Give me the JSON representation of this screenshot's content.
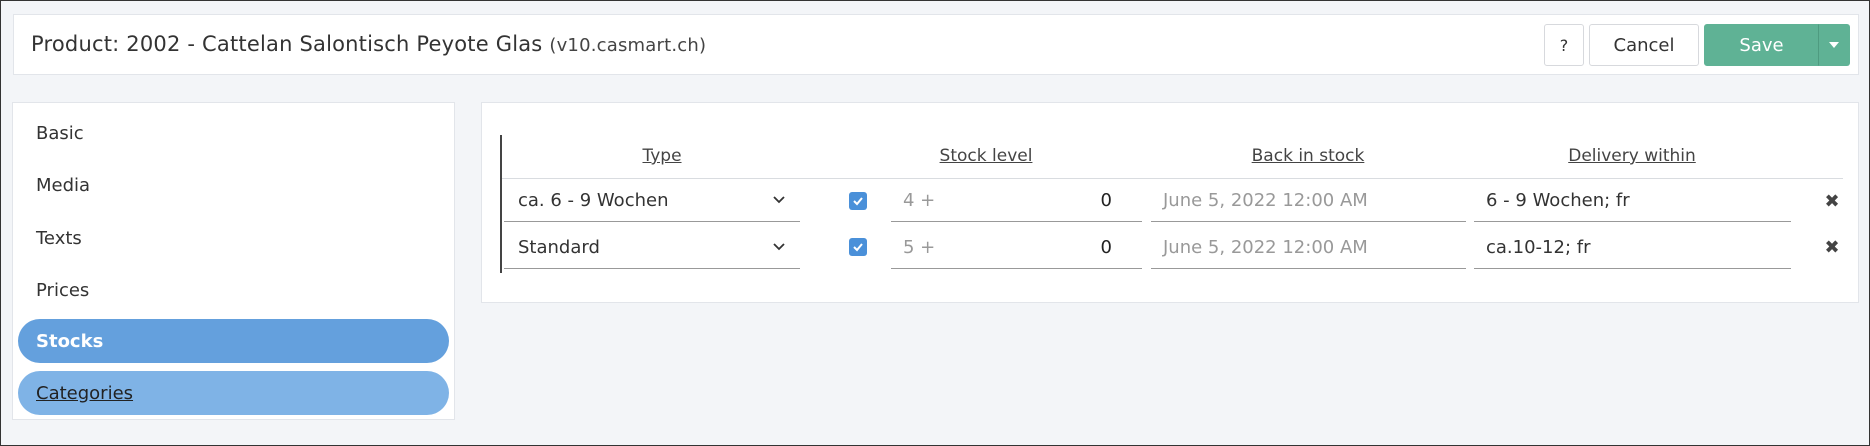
{
  "header": {
    "title": "Product: 2002 - Cattelan Salontisch Peyote Glas",
    "domain": "(v10.casmart.ch)",
    "help_label": "?",
    "cancel_label": "Cancel",
    "save_label": "Save"
  },
  "sidebar": {
    "items": [
      {
        "label": "Basic"
      },
      {
        "label": "Media"
      },
      {
        "label": "Texts"
      },
      {
        "label": "Prices"
      },
      {
        "label": "Stocks"
      },
      {
        "label": "Categories"
      }
    ]
  },
  "table": {
    "columns": [
      "Type",
      "Stock level",
      "Back in stock",
      "Delivery within"
    ],
    "rows": [
      {
        "type": "ca. 6 - 9 Wochen",
        "checked": true,
        "stock_placeholder": "4 +",
        "stock_value": "0",
        "back_in_stock": "June 5, 2022 12:00 AM",
        "delivery": "6 - 9 Wochen; fr"
      },
      {
        "type": "Standard",
        "checked": true,
        "stock_placeholder": "5 +",
        "stock_value": "0",
        "back_in_stock": "June 5, 2022 12:00 AM",
        "delivery": "ca.10-12; fr"
      }
    ]
  },
  "colors": {
    "active_nav": "#64a0dd",
    "hover_nav": "#7fb3e6",
    "save_button": "#5fb295",
    "checkbox": "#4a90d9"
  }
}
